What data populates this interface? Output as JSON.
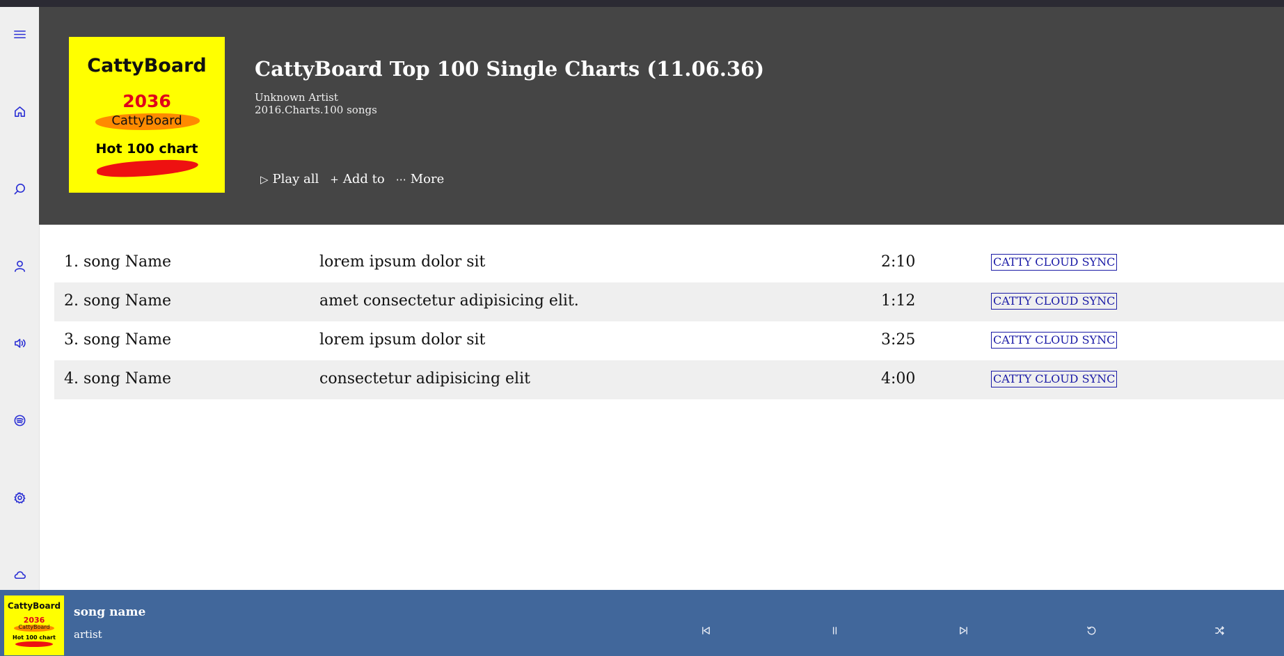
{
  "album": {
    "cover": {
      "brand": "CattyBoard",
      "year": "2036",
      "subtitle": "CattyBoard",
      "tagline": "Hot 100 chart"
    },
    "title": "CattyBoard Top 100 Single Charts (11.06.36)",
    "artist": "Unknown Artist",
    "meta": "2016.Charts.100 songs",
    "actions": {
      "play_all": "Play all",
      "add_to": "Add to",
      "more": "More"
    }
  },
  "sidebar": {
    "icons": [
      "menu-icon",
      "home-icon",
      "search-icon",
      "user-icon",
      "volume-icon",
      "spotify-icon",
      "settings-icon",
      "cloud-icon"
    ]
  },
  "tracks": [
    {
      "name": "1. song Name",
      "description": "lorem ipsum dolor sit",
      "duration": "2:10",
      "sync_label": "CATTY CLOUD SYNC"
    },
    {
      "name": "2. song Name",
      "description": "amet consectetur adipisicing elit.",
      "duration": "1:12",
      "sync_label": "CATTY CLOUD SYNC"
    },
    {
      "name": "3. song Name",
      "description": "lorem ipsum dolor sit",
      "duration": "3:25",
      "sync_label": "CATTY CLOUD SYNC"
    },
    {
      "name": "4. song Name",
      "description": "consectetur adipisicing elit",
      "duration": "4:00",
      "sync_label": "CATTY CLOUD SYNC"
    }
  ],
  "player": {
    "song": "song name",
    "artist": "artist",
    "cover": {
      "brand": "CattyBoard",
      "year": "2036",
      "subtitle": "CattyBoard",
      "tagline": "Hot 100 chart"
    }
  },
  "colors": {
    "header_bg": "#454545",
    "player_bg": "#41679b",
    "accent": "#2a2fd4",
    "cover_bg": "#ffff00"
  }
}
